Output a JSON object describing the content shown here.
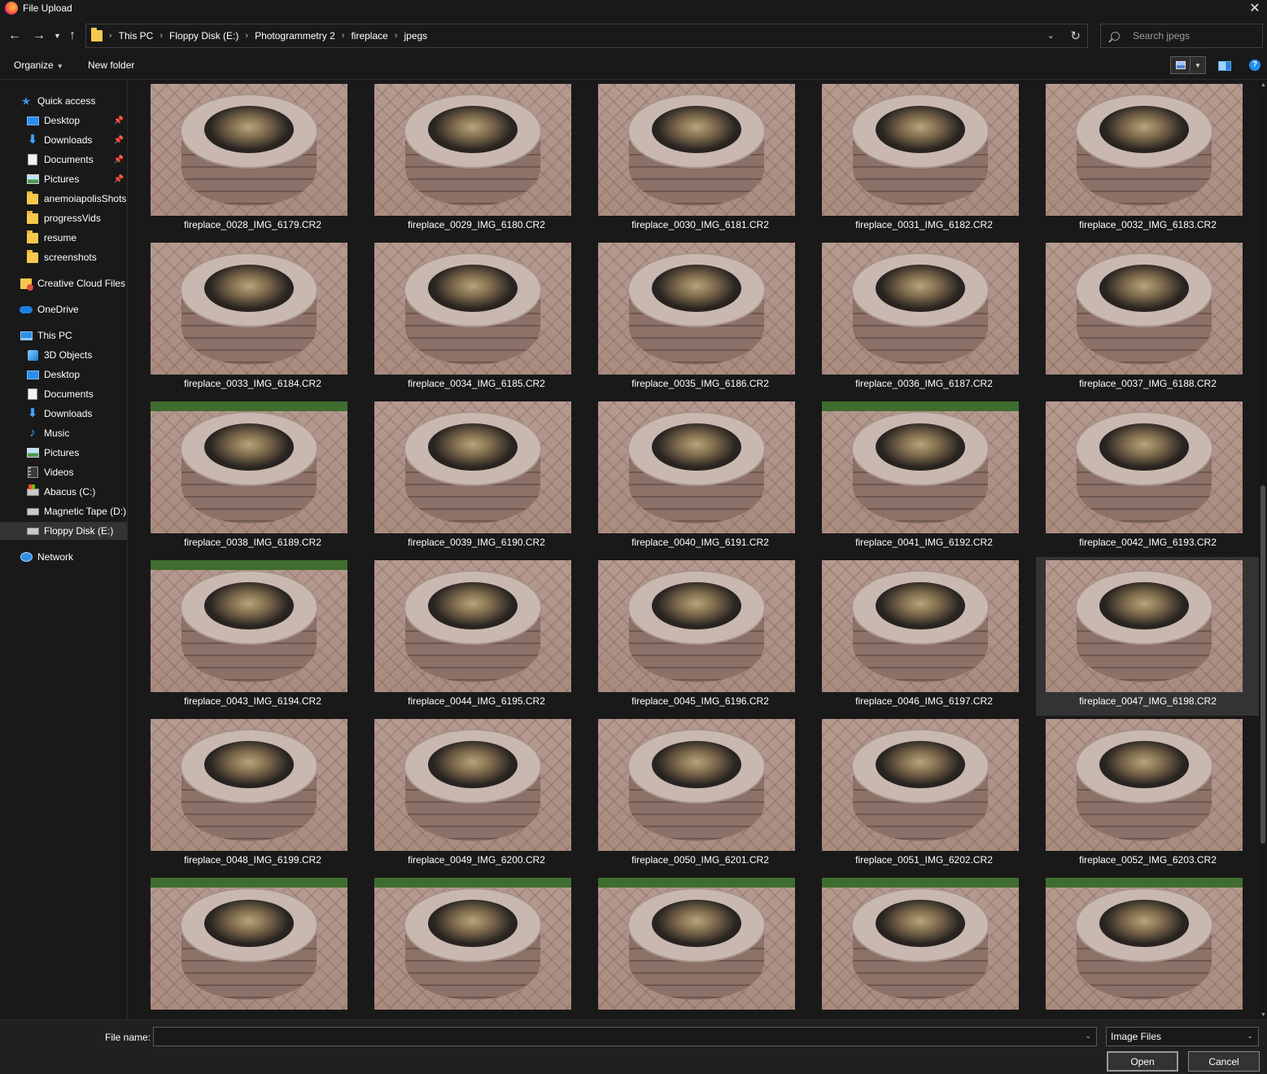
{
  "window": {
    "title": "File Upload",
    "close_glyph": "✕"
  },
  "address": {
    "crumbs": [
      "This PC",
      "Floppy Disk (E:)",
      "Photogrammetry 2",
      "fireplace",
      "jpegs"
    ],
    "search_placeholder": "Search jpegs"
  },
  "toolbar": {
    "organize_label": "Organize",
    "new_folder_label": "New folder",
    "help_label": "?"
  },
  "sidebar": {
    "quick_access": "Quick access",
    "quick_items": [
      {
        "label": "Desktop",
        "icon": "desktop-icon",
        "pinned": true
      },
      {
        "label": "Downloads",
        "icon": "downloads-icon",
        "pinned": true
      },
      {
        "label": "Documents",
        "icon": "documents-icon",
        "pinned": true
      },
      {
        "label": "Pictures",
        "icon": "pictures-icon",
        "pinned": true
      },
      {
        "label": "anemoiapolisShots",
        "icon": "folder-icon",
        "pinned": false
      },
      {
        "label": "progressVids",
        "icon": "folder-icon",
        "pinned": false
      },
      {
        "label": "resume",
        "icon": "folder-icon",
        "pinned": false
      },
      {
        "label": "screenshots",
        "icon": "folder-icon",
        "pinned": false
      }
    ],
    "creative_cloud": "Creative Cloud Files",
    "onedrive": "OneDrive",
    "this_pc": "This PC",
    "pc_items": [
      {
        "label": "3D Objects",
        "icon": "3d-objects-icon"
      },
      {
        "label": "Desktop",
        "icon": "desktop-icon"
      },
      {
        "label": "Documents",
        "icon": "documents-icon"
      },
      {
        "label": "Downloads",
        "icon": "downloads-icon"
      },
      {
        "label": "Music",
        "icon": "music-icon"
      },
      {
        "label": "Pictures",
        "icon": "pictures-icon"
      },
      {
        "label": "Videos",
        "icon": "videos-icon"
      },
      {
        "label": "Abacus (C:)",
        "icon": "system-drive-icon"
      },
      {
        "label": "Magnetic Tape (D:)",
        "icon": "drive-icon"
      },
      {
        "label": "Floppy Disk (E:)",
        "icon": "drive-icon",
        "selected": true
      }
    ],
    "network": "Network"
  },
  "files": [
    "fireplace_0028_IMG_6179.CR2",
    "fireplace_0029_IMG_6180.CR2",
    "fireplace_0030_IMG_6181.CR2",
    "fireplace_0031_IMG_6182.CR2",
    "fireplace_0032_IMG_6183.CR2",
    "fireplace_0033_IMG_6184.CR2",
    "fireplace_0034_IMG_6185.CR2",
    "fireplace_0035_IMG_6186.CR2",
    "fireplace_0036_IMG_6187.CR2",
    "fireplace_0037_IMG_6188.CR2",
    "fireplace_0038_IMG_6189.CR2",
    "fireplace_0039_IMG_6190.CR2",
    "fireplace_0040_IMG_6191.CR2",
    "fireplace_0041_IMG_6192.CR2",
    "fireplace_0042_IMG_6193.CR2",
    "fireplace_0043_IMG_6194.CR2",
    "fireplace_0044_IMG_6195.CR2",
    "fireplace_0045_IMG_6196.CR2",
    "fireplace_0046_IMG_6197.CR2",
    "fireplace_0047_IMG_6198.CR2",
    "fireplace_0048_IMG_6199.CR2",
    "fireplace_0049_IMG_6200.CR2",
    "fireplace_0050_IMG_6201.CR2",
    "fireplace_0051_IMG_6202.CR2",
    "fireplace_0052_IMG_6203.CR2"
  ],
  "highlighted_file": "fireplace_0047_IMG_6198.CR2",
  "bottom": {
    "file_name_label": "File name:",
    "file_name_value": "",
    "file_type": "Image Files",
    "open_label": "Open",
    "cancel_label": "Cancel"
  },
  "colors": {
    "background": "#191919",
    "accent": "#1e8ef0",
    "selected": "#333333"
  }
}
